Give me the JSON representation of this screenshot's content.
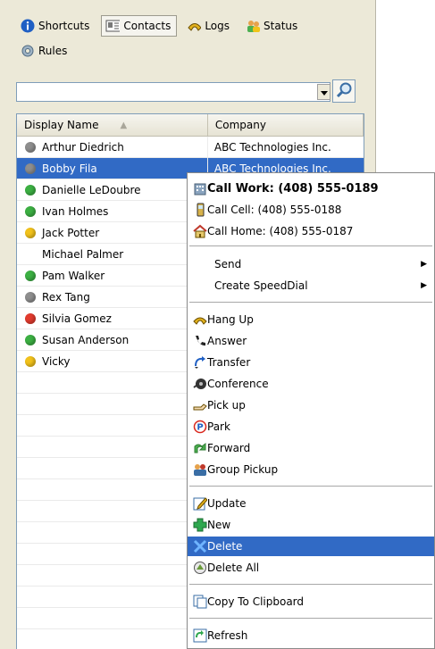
{
  "tabs": [
    {
      "label": "Shortcuts",
      "icon": "info-icon"
    },
    {
      "label": "Contacts",
      "icon": "contacts-card-icon",
      "active": true
    },
    {
      "label": "Logs",
      "icon": "phone-logs-icon"
    },
    {
      "label": "Status",
      "icon": "status-people-icon"
    },
    {
      "label": "Rules",
      "icon": "rules-gear-icon"
    }
  ],
  "search": {
    "value": "",
    "placeholder": ""
  },
  "columns": {
    "name": "Display Name",
    "company": "Company"
  },
  "contacts": [
    {
      "name": "Arthur Diedrich",
      "company": "ABC Technologies Inc.",
      "status": "gray"
    },
    {
      "name": "Bobby Fila",
      "company": "ABC Technologies Inc.",
      "status": "gray",
      "selected": true
    },
    {
      "name": "Danielle LeDoubre",
      "company": "",
      "status": "green"
    },
    {
      "name": "Ivan Holmes",
      "company": "",
      "status": "green"
    },
    {
      "name": "Jack  Potter",
      "company": "",
      "status": "yellow"
    },
    {
      "name": "Michael Palmer",
      "company": "",
      "status": "none"
    },
    {
      "name": "Pam Walker",
      "company": "",
      "status": "green"
    },
    {
      "name": "Rex Tang",
      "company": "",
      "status": "gray"
    },
    {
      "name": "Silvia Gomez",
      "company": "",
      "status": "red"
    },
    {
      "name": "Susan Anderson",
      "company": "",
      "status": "green"
    },
    {
      "name": "Vicky",
      "company": "",
      "status": "yellow"
    }
  ],
  "status_colors": {
    "green": "#3cb043",
    "gray": "#8e8e8e",
    "yellow": "#f2c21b",
    "red": "#e23b2e"
  },
  "context_menu": {
    "call_work": "Call Work: (408) 555-0189",
    "call_cell": "Call Cell: (408) 555-0188",
    "call_home": "Call Home: (408) 555-0187",
    "send": "Send",
    "create_speeddial": "Create SpeedDial",
    "hang_up": "Hang Up",
    "answer": "Answer",
    "transfer": "Transfer",
    "conference": "Conference",
    "pick_up": "Pick up",
    "park": "Park",
    "forward": "Forward",
    "group_pickup": "Group Pickup",
    "update": "Update",
    "new": "New",
    "delete": "Delete",
    "delete_all": "Delete All",
    "copy_to_clipboard": "Copy To Clipboard",
    "refresh": "Refresh"
  },
  "accent_color": "#316ac5"
}
